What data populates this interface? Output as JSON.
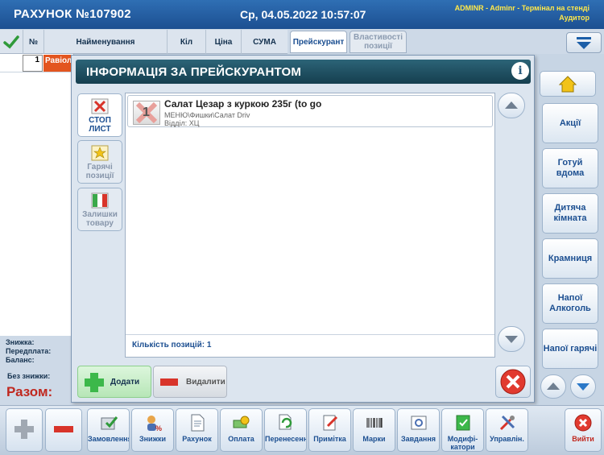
{
  "title": {
    "invoice": "РАХУНОК  №107902",
    "datetime": "Ср, 04.05.2022  10:57:07",
    "user_line1": "ADMINR - Adminr - Термінал на стенді",
    "user_line2": "Аудитор"
  },
  "order_table": {
    "headers": {
      "no": "№",
      "name": "Найменування",
      "qty": "Кіл",
      "price": "Ціна",
      "sum": "СУМА"
    },
    "rows": [
      {
        "no": "1",
        "name": "Равіол"
      }
    ]
  },
  "summary": {
    "discount": "Знижка:",
    "prepayment": "Передплата:",
    "balance": "Баланс:",
    "no_discount": "Без знижки:",
    "total": "Разом:"
  },
  "tabs": {
    "price_list": "Прейскурант",
    "properties": "Властивості позиції"
  },
  "categories": [
    "Акції",
    "Готуй вдома",
    "Дитяча кімната",
    "Крамниця",
    "Напої Алкоголь",
    "Напої гарячі"
  ],
  "modal": {
    "title": "ІНФОРМАЦІЯ ЗА ПРЕЙСКУРАНТОМ",
    "info_label": "i",
    "side_tabs": [
      "СТОП ЛИСТ",
      "Гарячі позиції",
      "Залишки товару"
    ],
    "item": {
      "qty": "1",
      "name": "Салат Цезар з куркою 235г (to go",
      "path": "МЕНЮ\\Фишки\\Салат Driv",
      "department": "Відділ: ХЦ"
    },
    "count_label": "Кількість позицій: 1",
    "add_label": "Додати",
    "delete_label": "Видалити"
  },
  "bottom_buttons": [
    "Замовлення",
    "Знижки",
    "Рахунок",
    "Оплата",
    "Перенесенн",
    "Примітка",
    "Марки",
    "Завдання",
    "Модифі-\nкатори",
    "Управлін."
  ],
  "exit_label": "Вийти",
  "colors": {
    "accent": "#1c4f91",
    "danger": "#e13a2f",
    "ok": "#2f9a3a"
  }
}
